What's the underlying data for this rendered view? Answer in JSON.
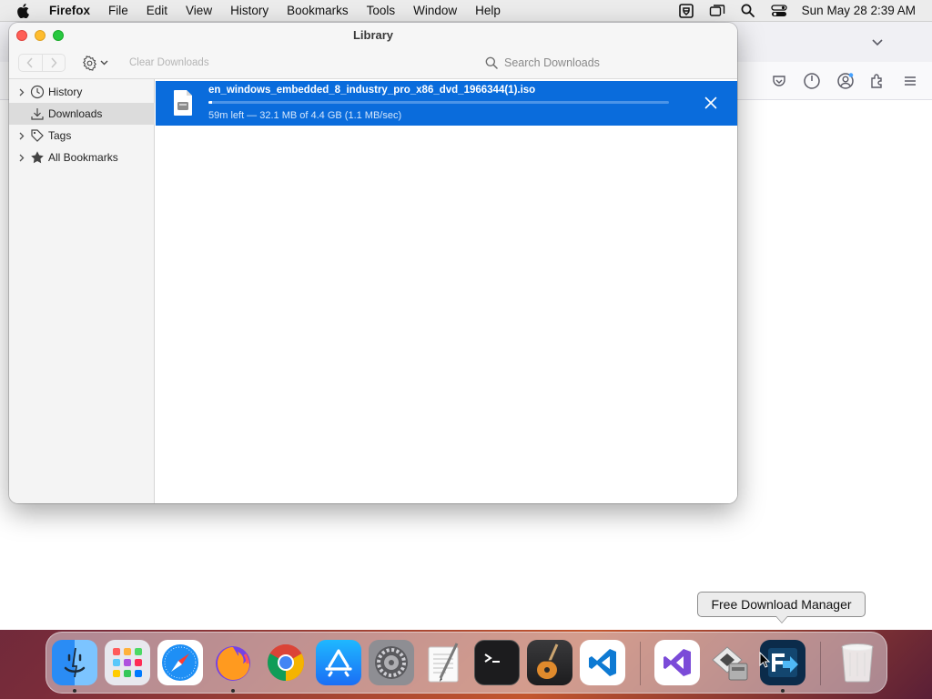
{
  "menubar": {
    "app_name": "Firefox",
    "items": [
      "File",
      "Edit",
      "View",
      "History",
      "Bookmarks",
      "Tools",
      "Window",
      "Help"
    ],
    "clock": "Sun May 28  2:39 AM",
    "status_icons": [
      "screen-capture-icon",
      "screen-mirroring-icon",
      "spotlight-search-icon",
      "control-center-icon"
    ]
  },
  "library": {
    "title": "Library",
    "toolbar": {
      "clear_label": "Clear Downloads",
      "search_placeholder": "Search Downloads"
    },
    "sidebar": {
      "items": [
        {
          "label": "History",
          "icon": "clock-icon",
          "expandable": true,
          "selected": false
        },
        {
          "label": "Downloads",
          "icon": "download-icon",
          "expandable": false,
          "selected": true
        },
        {
          "label": "Tags",
          "icon": "tag-icon",
          "expandable": true,
          "selected": false
        },
        {
          "label": "All Bookmarks",
          "icon": "star-icon",
          "expandable": true,
          "selected": false
        }
      ]
    },
    "downloads": [
      {
        "filename": "en_windows_embedded_8_industry_pro_x86_dvd_1966344(1).iso",
        "status": "59m left — 32.1 MB of 4.4 GB (1.1 MB/sec)",
        "progress_fraction": 0.0073
      }
    ]
  },
  "tooltip": {
    "text": "Free Download Manager"
  },
  "dock": {
    "apps": [
      "Finder",
      "Launchpad",
      "Safari",
      "Firefox",
      "Google Chrome",
      "App Store",
      "System Preferences",
      "TextEdit",
      "Terminal",
      "GarageBand",
      "Visual Studio Code",
      "Visual Studio",
      "Migration Assistant",
      "Free Download Manager",
      "Trash"
    ]
  },
  "colors": {
    "selection_blue": "#0a6cdc",
    "traffic_red": "#ff5f57",
    "traffic_yellow": "#febc2e",
    "traffic_green": "#28c840"
  }
}
